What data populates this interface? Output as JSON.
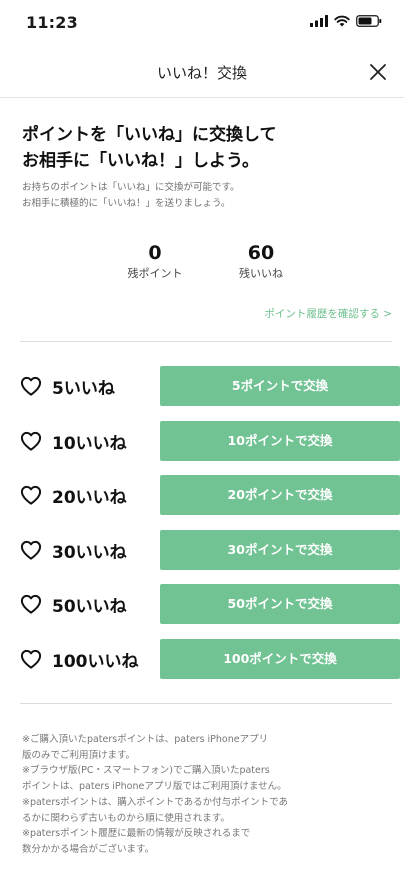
{
  "status_bar": {
    "time": "11:23",
    "icons": [
      "signal-icon",
      "wifi-icon",
      "battery-icon"
    ]
  },
  "header": {
    "title": "いいね！交換",
    "close_icon": "close-icon"
  },
  "intro": {
    "heading_line1": "ポイントを「いいね」に交換して",
    "heading_line2": "お相手に「いいね！」しよう。",
    "desc_line1": "お持ちのポイントは「いいね」に交換が可能です。",
    "desc_line2": "お相手に積極的に「いいね！」を送りましょう。"
  },
  "stats": {
    "remaining_points": {
      "value": "0",
      "label": "残ポイント"
    },
    "remaining_likes": {
      "value": "60",
      "label": "残いいね"
    }
  },
  "history_link": "ポイント履歴を確認する >",
  "exchange_options": [
    {
      "label": "5いいね",
      "button": "5ポイントで交換"
    },
    {
      "label": "10いいね",
      "button": "10ポイントで交換"
    },
    {
      "label": "20いいね",
      "button": "20ポイントで交換"
    },
    {
      "label": "30いいね",
      "button": "30ポイントで交換"
    },
    {
      "label": "50いいね",
      "button": "50ポイントで交換"
    },
    {
      "label": "100いいね",
      "button": "100ポイントで交換"
    }
  ],
  "notes": [
    "※ご購入頂いたpatersポイントは、paters iPhoneアプリ",
    "版のみでご利用頂けます。",
    "※ブラウザ版(PC・スマートフォン)でご購入頂いたpaters",
    "ポイントは、paters iPhoneアプリ版ではご利用頂けません。",
    "※patersポイントは、購入ポイントであるか付与ポイントであ",
    "るかに関わらず古いものから順に使用されます。",
    "※patersポイント履歴に最新の情報が反映されるまで",
    "数分かかる場合がございます。"
  ],
  "colors": {
    "accent_green": "#72c394",
    "link_green": "#6cbf8c",
    "text_muted": "#6f6f6f"
  }
}
